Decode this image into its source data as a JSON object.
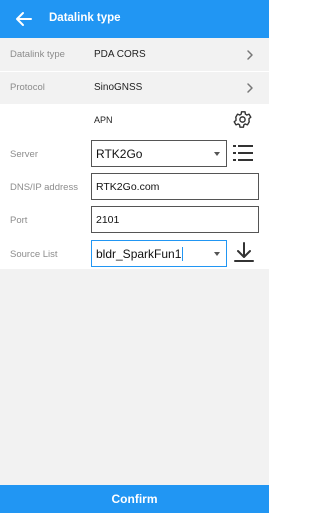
{
  "header": {
    "title": "Datalink type"
  },
  "rows": [
    {
      "label": "Datalink type",
      "value": "PDA CORS"
    },
    {
      "label": "Protocol",
      "value": "SinoGNSS"
    }
  ],
  "apn": {
    "label": "APN"
  },
  "fields": {
    "server": {
      "label": "Server",
      "value": "RTK2Go"
    },
    "dns": {
      "label": "DNS/IP address",
      "value": "RTK2Go.com"
    },
    "port": {
      "label": "Port",
      "value": "2101"
    },
    "source": {
      "label": "Source List",
      "value": "bldr_SparkFun1"
    }
  },
  "footer": {
    "confirm_label": "Confirm"
  },
  "colors": {
    "accent": "#2196f3",
    "panel": "#f2f2f2"
  },
  "icons": [
    "back-arrow-icon",
    "chevron-right-icon",
    "gear-icon",
    "list-icon",
    "download-icon",
    "dropdown-arrow-icon"
  ]
}
